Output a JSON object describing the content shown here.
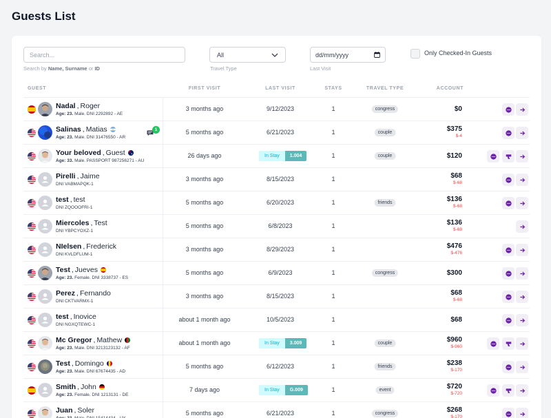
{
  "page": {
    "title": "Guests List"
  },
  "filters": {
    "search_placeholder": "Search...",
    "search_hint_prefix": "Search by",
    "search_hint_name": "Name,",
    "search_hint_surname": "Surname",
    "search_hint_or": "or",
    "search_hint_id": "ID",
    "travel_type_value": "All",
    "travel_type_label": "Travel Type",
    "last_visit_value": "dd/mm/yyyy",
    "last_visit_label": "Last Visit",
    "checked_in_label": "Only Checked-In Guests"
  },
  "table": {
    "headers": {
      "guest": "GUEST",
      "first_visit": "FIRST VISIT",
      "last_visit": "LAST VISIT",
      "stays": "STAYS",
      "travel_type": "TRAVEL TYPE",
      "account": "ACCOUNT"
    },
    "rows": [
      {
        "surname": "Nadal",
        "name": " Roger",
        "flag": "es",
        "avatar": "photo-dark",
        "age_label": "Age: 23.",
        "detail": " Male. DNI 2292892 - AE",
        "first_visit": "3 months ago",
        "last_visit": "9/12/2023",
        "stays": "1",
        "travel_type": "congress",
        "amount": "$0",
        "owed": "",
        "actions": [
          "chat",
          "go"
        ]
      },
      {
        "surname": "Salinas",
        "name": " Matias",
        "flag": "us",
        "avatar": "blue",
        "name_flag": "ar",
        "age_label": "Age: 23.",
        "detail": " Male. DNI 31476550 - AR",
        "chat_count": "1",
        "first_visit": "5 months ago",
        "last_visit": "6/21/2023",
        "stays": "1",
        "travel_type": "couple",
        "amount": "$375",
        "owed": "$-4",
        "actions": [
          "chat",
          "go"
        ]
      },
      {
        "surname": "Your beloved",
        "name": " Guest",
        "flag": "us",
        "avatar": "photo-light",
        "name_flag": "au",
        "age_label": "Age: 33.",
        "detail": " Male. PASSPORT 987256271 - AU",
        "first_visit": "26 days ago",
        "in_stay": "In Stay",
        "room": "1.004",
        "stays": "1",
        "travel_type": "couple",
        "amount": "$120",
        "owed": "",
        "actions": [
          "chat",
          "key",
          "go"
        ]
      },
      {
        "surname": "Pirelli",
        "name": " Jaime",
        "flag": "us",
        "avatar": "placeholder",
        "age_label": "",
        "detail": "DNI VABMAPQK-1",
        "first_visit": "3 months ago",
        "last_visit": "8/15/2023",
        "stays": "1",
        "travel_type": "",
        "amount": "$68",
        "owed": "$-68",
        "actions": [
          "chat",
          "go"
        ]
      },
      {
        "surname": "test",
        "name": " test",
        "flag": "us",
        "avatar": "placeholder",
        "age_label": "",
        "detail": "DNI ZQOOOFRI-1",
        "first_visit": "5 months ago",
        "last_visit": "6/20/2023",
        "stays": "1",
        "travel_type": "friends",
        "amount": "$136",
        "owed": "$-68",
        "actions": [
          "chat",
          "go"
        ]
      },
      {
        "surname": "Miercoles",
        "name": " Test",
        "flag": "us",
        "avatar": "placeholder",
        "age_label": "",
        "detail": "DNI YBPCYOXZ-1",
        "first_visit": "5 months ago",
        "last_visit": "6/8/2023",
        "stays": "1",
        "travel_type": "",
        "amount": "$136",
        "owed": "$-68",
        "actions": [
          "go"
        ]
      },
      {
        "surname": "NIelsen",
        "name": " Frederick",
        "flag": "us",
        "avatar": "placeholder",
        "age_label": "",
        "detail": "DNI KVLDFLUM-1",
        "first_visit": "3 months ago",
        "last_visit": "8/29/2023",
        "stays": "1",
        "travel_type": "",
        "amount": "$476",
        "owed": "$-476",
        "actions": [
          "chat",
          "go"
        ]
      },
      {
        "surname": "Test",
        "name": " Jueves",
        "flag": "us",
        "avatar": "photo-dark",
        "name_flag": "es",
        "age_label": "Age: 23.",
        "detail": " Female. DNI 3338737 - ES",
        "first_visit": "5 months ago",
        "last_visit": "6/9/2023",
        "stays": "1",
        "travel_type": "congress",
        "amount": "$300",
        "owed": "",
        "actions": [
          "chat",
          "go"
        ]
      },
      {
        "surname": "Perez",
        "name": " Fernando",
        "flag": "us",
        "avatar": "placeholder",
        "age_label": "",
        "detail": "DNI CKTVARMX-1",
        "first_visit": "3 months ago",
        "last_visit": "8/15/2023",
        "stays": "1",
        "travel_type": "",
        "amount": "$68",
        "owed": "$-68",
        "actions": [
          "chat",
          "go"
        ]
      },
      {
        "surname": "test",
        "name": " Inovice",
        "flag": "us",
        "avatar": "placeholder",
        "age_label": "",
        "detail": "DNI NGXQTEWC-1",
        "first_visit": "about 1 month ago",
        "last_visit": "10/5/2023",
        "stays": "1",
        "travel_type": "",
        "amount": "$68",
        "owed": "",
        "actions": [
          "chat",
          "go"
        ]
      },
      {
        "surname": "Mc Gregor",
        "name": " Mathew",
        "flag": "us",
        "avatar": "photo-light",
        "name_flag": "af",
        "age_label": "Age: 23.",
        "detail": " Male. DNI 3213123132 - AF",
        "first_visit": "about 1 month ago",
        "in_stay": "In Stay",
        "room": "3.009",
        "stays": "1",
        "travel_type": "couple",
        "amount": "$960",
        "owed": "$-960",
        "actions": [
          "chat",
          "key",
          "go"
        ]
      },
      {
        "surname": "Test",
        "name": " Domingo",
        "flag": "us",
        "avatar": "photo-gray",
        "name_flag": "ad",
        "age_label": "Age: 23.",
        "detail": " Male. DNI 67674435 - AD",
        "first_visit": "5 months ago",
        "last_visit": "6/12/2023",
        "stays": "1",
        "travel_type": "friends",
        "amount": "$238",
        "owed": "$-170",
        "actions": [
          "chat",
          "go"
        ]
      },
      {
        "surname": "Smith",
        "name": " John",
        "flag": "es",
        "avatar": "placeholder",
        "name_flag": "de",
        "age_label": "Age: 23.",
        "detail": " Female. DNI 1213131 - DE",
        "first_visit": "7 days ago",
        "in_stay": "In Stay",
        "room": "G.009",
        "stays": "1",
        "travel_type": "event",
        "amount": "$720",
        "owed": "$-720",
        "actions": [
          "chat",
          "key",
          "go"
        ]
      },
      {
        "surname": "Juan",
        "name": " Soler",
        "flag": "us",
        "avatar": "photo-light",
        "age_label": "Age: 23.",
        "detail": " Male. DNI 15414434 - UY",
        "first_visit": "5 months ago",
        "last_visit": "6/21/2023",
        "stays": "1",
        "travel_type": "congress",
        "amount": "$268",
        "owed": "$-170",
        "actions": [
          "chat",
          "go"
        ]
      }
    ]
  }
}
